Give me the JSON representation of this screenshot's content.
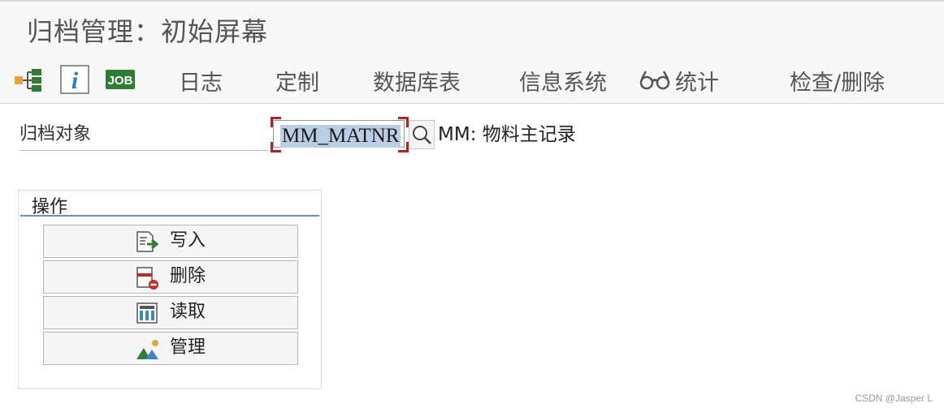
{
  "header": {
    "title": "归档管理：初始屏幕"
  },
  "toolbar": {
    "icons": [
      "hierarchy-icon",
      "info-icon",
      "job-icon"
    ],
    "job_label": "JOB",
    "info_label": "i",
    "items": [
      {
        "label": "日志"
      },
      {
        "label": "定制"
      },
      {
        "label": "数据库表"
      },
      {
        "label": "信息系统"
      },
      {
        "label": "统计",
        "icon": "glasses-icon"
      },
      {
        "label": "检查/删除"
      }
    ]
  },
  "form": {
    "field_label": "归档对象",
    "object_value": "MM_MATNR",
    "object_description": "MM: 物料主记录"
  },
  "actions": {
    "title": "操作",
    "buttons": [
      {
        "label": "写入",
        "icon": "write-icon"
      },
      {
        "label": "删除",
        "icon": "delete-icon"
      },
      {
        "label": "读取",
        "icon": "read-icon"
      },
      {
        "label": "管理",
        "icon": "manage-icon"
      }
    ]
  },
  "watermark": "CSDN @Jasper L",
  "colors": {
    "accent_line": "#5b9bc4",
    "focus_corner": "#b42222",
    "selection": "#b9cde5",
    "job_green": "#2e7d32"
  }
}
